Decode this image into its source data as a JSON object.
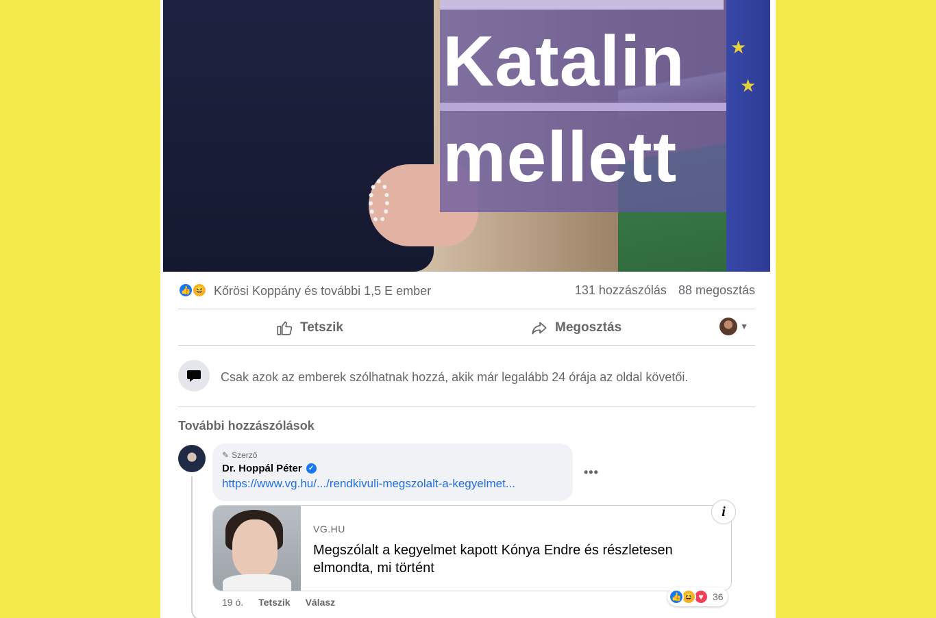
{
  "hero": {
    "line1": "Katalin",
    "line2": "mellett"
  },
  "summary": {
    "reactors": "Kőrösi Koppány és további 1,5 E ember",
    "comments": "131 hozzászólás",
    "shares": "88 megosztás",
    "reaction_icons": [
      "like-icon",
      "haha-icon"
    ]
  },
  "actions": {
    "like": "Tetszik",
    "share": "Megosztás"
  },
  "notice": {
    "text": "Csak azok az emberek szólhatnak hozzá, akik már legalább 24 órája az oldal követői."
  },
  "comments_section": {
    "title": "További hozzászólások"
  },
  "comment": {
    "badge": "Szerző",
    "author": "Dr. Hoppál Péter",
    "link": "https://www.vg.hu/.../rendkivuli-megszolalt-a-kegyelmet...",
    "preview": {
      "source": "VG.HU",
      "headline": "Megszólalt a kegyelmet kapott Kónya Endre és részletesen elmondta, mi történt"
    },
    "time": "19 ó.",
    "like": "Tetszik",
    "reply": "Válasz",
    "reaction_count": "36"
  },
  "colors": {
    "background": "#f5ea4c",
    "link": "#216fdb",
    "like_blue": "#1877f2",
    "muted_text": "#65676b"
  }
}
